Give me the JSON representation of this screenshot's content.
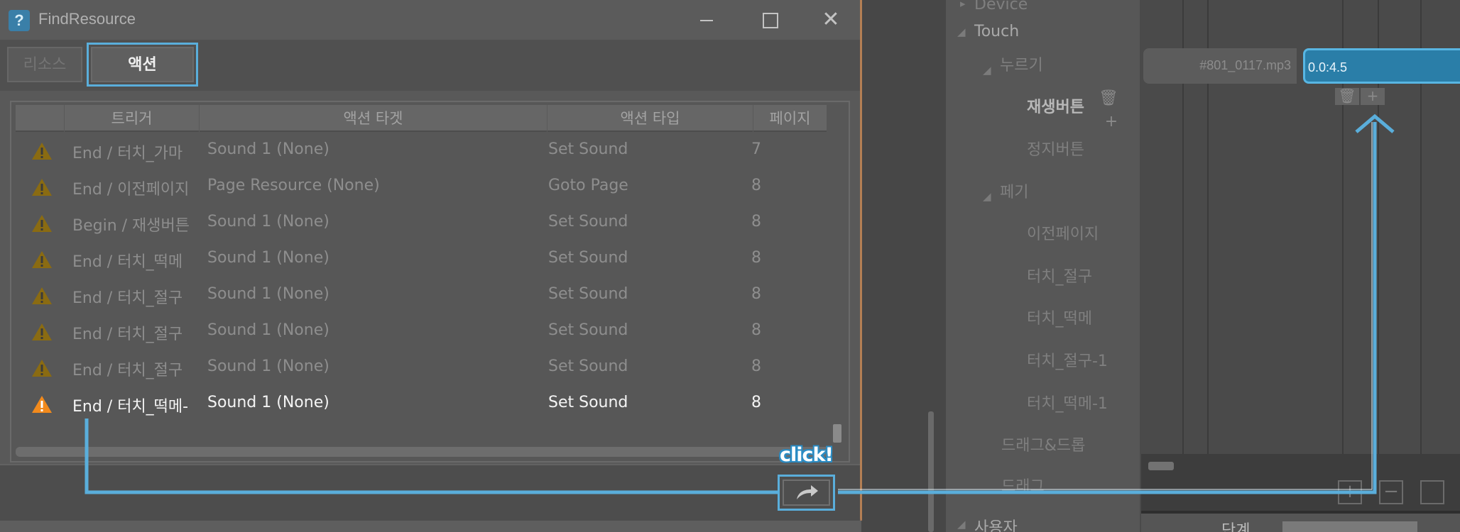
{
  "dialog": {
    "title": "FindResource",
    "tabs": [
      {
        "label": "리소스",
        "active": false
      },
      {
        "label": "액션",
        "active": true
      }
    ],
    "columns": [
      "트리거",
      "액션 타겟",
      "액션 타입",
      "페이지"
    ],
    "rows": [
      {
        "trigger": "End / 터치_가마",
        "target": "Sound 1 (None)",
        "type": "Set Sound",
        "page": "7",
        "selected": false
      },
      {
        "trigger": "End / 이전페이지",
        "target": "Page Resource (None)",
        "type": "Goto Page",
        "page": "8",
        "selected": false
      },
      {
        "trigger": "Begin / 재생버튼",
        "target": "Sound 1 (None)",
        "type": "Set Sound",
        "page": "8",
        "selected": false
      },
      {
        "trigger": "End / 터치_떡메",
        "target": "Sound 1 (None)",
        "type": "Set Sound",
        "page": "8",
        "selected": false
      },
      {
        "trigger": "End / 터치_절구",
        "target": "Sound 1 (None)",
        "type": "Set Sound",
        "page": "8",
        "selected": false
      },
      {
        "trigger": "End / 터치_절구",
        "target": "Sound 1 (None)",
        "type": "Set Sound",
        "page": "8",
        "selected": false
      },
      {
        "trigger": "End / 터치_절구",
        "target": "Sound 1 (None)",
        "type": "Set Sound",
        "page": "8",
        "selected": false
      },
      {
        "trigger": "End / 터치_떡메-",
        "target": "Sound 1 (None)",
        "type": "Set Sound",
        "page": "8",
        "selected": true
      }
    ],
    "goto_button_icon": "share-arrow-icon"
  },
  "annotation": {
    "click_label": "click!",
    "color": "#5aaedb"
  },
  "background": {
    "tree": {
      "device": "Device",
      "touch": "Touch",
      "press_group": "누르기",
      "play_button": "재생버튼",
      "stop_button": "정지버튼",
      "turn_page": "페기",
      "prev_page": "이전페이지",
      "touch_jeolgu": "터치_절구",
      "touch_ttokme": "터치_떡메",
      "touch_jeolgu_1": "터치_절구-1",
      "touch_ttokme_1": "터치_떡메-1",
      "drag_drop": "드래그&드롭",
      "drag": "드래그",
      "user": "사용자"
    },
    "timeline": {
      "clip1_label": "#801_0117.mp3",
      "clip2_label": "0.0:4.5",
      "bottom_label": "단계"
    }
  }
}
